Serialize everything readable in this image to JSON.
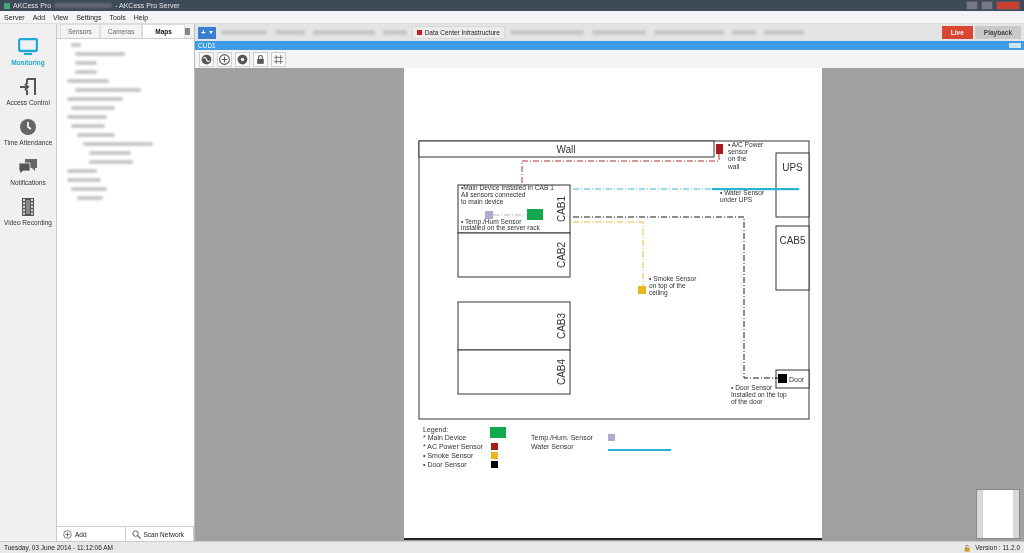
{
  "window": {
    "title": "AKCess Pro",
    "title_suffix": "- AKCess Pro Server"
  },
  "menu": [
    "Server",
    "Add",
    "View",
    "Settings",
    "Tools",
    "Help"
  ],
  "nav": [
    {
      "label": "Monitoring",
      "kind": "monitor",
      "selected": true
    },
    {
      "label": "Access Control",
      "kind": "door",
      "selected": false
    },
    {
      "label": "Time Attendance",
      "kind": "clock",
      "selected": false
    },
    {
      "label": "Notifications",
      "kind": "chat",
      "selected": false
    },
    {
      "label": "Video Recording",
      "kind": "film",
      "selected": false
    }
  ],
  "panel_tabs": [
    {
      "label": "Sensors",
      "selected": false
    },
    {
      "label": "Cameras",
      "selected": false
    },
    {
      "label": "Maps",
      "selected": true
    }
  ],
  "panel_buttons": [
    {
      "label": "Add",
      "kind": "add"
    },
    {
      "label": "Scan Network",
      "kind": "search"
    }
  ],
  "add_button": "+",
  "map_tabs": [
    {
      "label": "Data Center Infrastructure",
      "selected": false
    }
  ],
  "mode_buttons": [
    {
      "label": "Live",
      "selected": true
    },
    {
      "label": "Playback",
      "selected": false
    }
  ],
  "view": {
    "title": "CUD1"
  },
  "floor_plan": {
    "wall": "Wall",
    "cabinets": [
      {
        "label": "CAB1"
      },
      {
        "label": "CAB2"
      },
      {
        "label": "CAB3"
      },
      {
        "label": "CAB4"
      },
      {
        "label": "UPS"
      },
      {
        "label": "CAB5"
      }
    ],
    "door": "Door",
    "sensors": [
      {
        "kind": "main",
        "color": "#12a84c",
        "note": [
          "•Main Device Installed in CAB 1",
          "All sensors connected",
          "to main device"
        ]
      },
      {
        "kind": "temp",
        "color": "#b4a8cc",
        "note": [
          "• Temp./Hum Sensor",
          "installed on the server rack"
        ]
      },
      {
        "kind": "power",
        "color": "#a81c1c",
        "note": [
          "• A/C Power",
          "sensor",
          "on the",
          "wall"
        ]
      },
      {
        "kind": "water",
        "color": "#27b2d6",
        "note": [
          "• Water Sensor",
          "under UPS"
        ]
      },
      {
        "kind": "smoke",
        "color": "#e8b622",
        "note": [
          "• Smoke Sensor",
          "on top of the",
          "ceiling"
        ]
      },
      {
        "kind": "door",
        "color": "#000000",
        "note": [
          "• Door Sensor",
          "Installed on the top",
          "of the door"
        ]
      }
    ],
    "legend_title": "Legend:",
    "legend": [
      {
        "label": "* Main Device",
        "color": "#12a84c",
        "kind": "big"
      },
      {
        "label": "* AC Power Sensor",
        "color": "#a81c1c",
        "kind": "square"
      },
      {
        "label": "• Smoke Sensor",
        "color": "#e8b622",
        "kind": "square"
      },
      {
        "label": "• Door Sensor",
        "color": "#000000",
        "kind": "square"
      },
      {
        "label": "Temp./Hum. Sensor",
        "color": "#b4a8cc",
        "kind": "small"
      },
      {
        "label": "Water Sensor",
        "color": "#27b2d6",
        "kind": "line"
      }
    ]
  },
  "status_bar": {
    "datetime": "Tuesday, 03 June 2014 - 11:12:06 AM",
    "version": "Version : 11.2.0"
  }
}
